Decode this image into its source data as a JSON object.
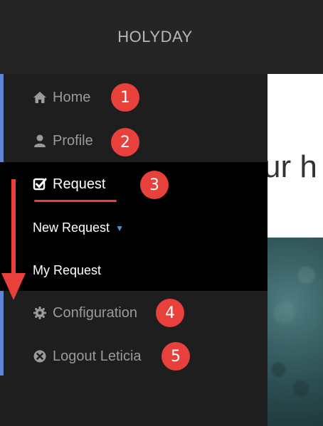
{
  "app": {
    "title": "HOLYDAY"
  },
  "content": {
    "heading_fragment": "ur h"
  },
  "sidebar": {
    "items": [
      {
        "label": "Home",
        "icon": "home-icon",
        "badge": "1"
      },
      {
        "label": "Profile",
        "icon": "user-icon",
        "badge": "2"
      },
      {
        "label": "Request",
        "icon": "check-square-icon",
        "badge": "3",
        "active": true
      },
      {
        "label": "Configuration",
        "icon": "gear-icon",
        "badge": "4"
      },
      {
        "label": "Logout Leticia",
        "icon": "close-circle-icon",
        "badge": "5"
      }
    ],
    "submenu": [
      {
        "label": "New Request",
        "has_dropdown": true
      },
      {
        "label": "My Request"
      }
    ]
  },
  "colors": {
    "header_bg": "#252525",
    "sidebar_bg": "#1e1e1e",
    "active_bg": "#000000",
    "accent": "#5f85d6",
    "badge": "#e8403a"
  }
}
